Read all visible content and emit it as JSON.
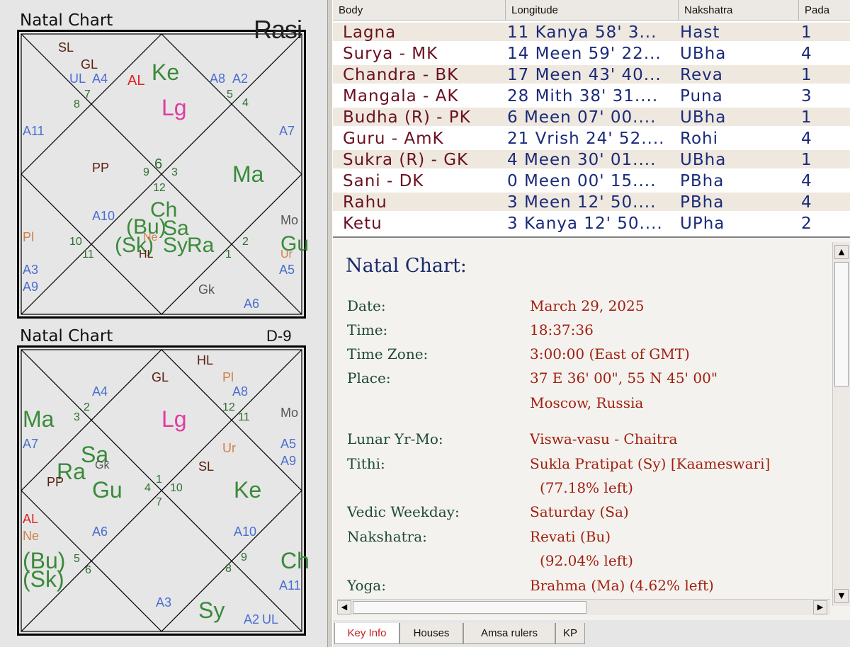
{
  "rasi": {
    "title": "Natal Chart",
    "name": "Rasi",
    "labels": {
      "sl": "SL",
      "gl": "GL",
      "ul": "UL",
      "a4": "A4",
      "al": "AL",
      "ke": "Ke",
      "a8": "A8",
      "a2": "A2",
      "lg": "Lg",
      "n7": "7",
      "n8": "8",
      "n5": "5",
      "n4": "4",
      "a11": "A11",
      "a7": "A7",
      "pp": "PP",
      "n9": "9",
      "n6": "6",
      "n3": "3",
      "n12": "12",
      "ma": "Ma",
      "a10": "A10",
      "ch": "Ch",
      "bu": "(Bu)",
      "sa": "Sa",
      "mo": "Mo",
      "pl": "Pl",
      "n10": "10",
      "n11": "11",
      "sk": "(Sk)",
      "ne": "Ne",
      "sy": "Sy",
      "ra": "Ra",
      "hl": "HL",
      "n1": "1",
      "n2": "2",
      "gu": "Gu",
      "ur": "Ur",
      "a3": "A3",
      "a5": "A5",
      "a9": "A9",
      "gk": "Gk",
      "a6": "A6"
    }
  },
  "d9": {
    "title": "Natal Chart",
    "name": "D-9",
    "labels": {
      "hl": "HL",
      "gl": "GL",
      "pl": "Pl",
      "a4": "A4",
      "a8": "A8",
      "lg": "Lg",
      "n3": "3",
      "n2": "2",
      "n12": "12",
      "n11": "11",
      "mo": "Mo",
      "ma": "Ma",
      "a7": "A7",
      "ur": "Ur",
      "a5": "A5",
      "a9": "A9",
      "sa": "Sa",
      "ra": "Ra",
      "gk": "Gk",
      "pp": "PP",
      "gu": "Gu",
      "n4": "4",
      "n1": "1",
      "n10": "10",
      "n7": "7",
      "sl": "SL",
      "ke": "Ke",
      "al": "AL",
      "ne": "Ne",
      "a6": "A6",
      "a10": "A10",
      "bu": "(Bu)",
      "sk": "(Sk)",
      "n5": "5",
      "n6": "6",
      "n9": "9",
      "n8": "8",
      "ch": "Ch",
      "a11": "A11",
      "a3": "A3",
      "sy": "Sy",
      "a2": "A2",
      "ul": "UL"
    }
  },
  "table": {
    "headers": [
      "Body",
      "Longitude",
      "Nakshatra",
      "Pada"
    ],
    "rows": [
      {
        "body": "Lagna",
        "longitude": "11 Kanya 58' 3...",
        "nakshatra": "Hast",
        "pada": "1"
      },
      {
        "body": "Surya - MK",
        "longitude": "14 Meen 59' 22...",
        "nakshatra": "UBha",
        "pada": "4"
      },
      {
        "body": "Chandra - BK",
        "longitude": "17 Meen 43' 40...",
        "nakshatra": "Reva",
        "pada": "1"
      },
      {
        "body": "Mangala - AK",
        "longitude": "28 Mith 38' 31....",
        "nakshatra": "Puna",
        "pada": "3"
      },
      {
        "body": "Budha (R) - PK",
        "longitude": "6 Meen 07' 00....",
        "nakshatra": "UBha",
        "pada": "1"
      },
      {
        "body": "Guru - AmK",
        "longitude": "21 Vrish 24' 52....",
        "nakshatra": "Rohi",
        "pada": "4"
      },
      {
        "body": "Sukra (R) - GK",
        "longitude": "4 Meen 30' 01....",
        "nakshatra": "UBha",
        "pada": "1"
      },
      {
        "body": "Sani - DK",
        "longitude": "0 Meen 00' 15....",
        "nakshatra": "PBha",
        "pada": "4"
      },
      {
        "body": "Rahu",
        "longitude": "3 Meen 12' 50....",
        "nakshatra": "PBha",
        "pada": "4"
      },
      {
        "body": "Ketu",
        "longitude": "3 Kanya 12' 50....",
        "nakshatra": "UPha",
        "pada": "2"
      }
    ]
  },
  "info": {
    "title": "Natal Chart:",
    "date_label": "Date:",
    "date": "March 29, 2025",
    "time_label": "Time:",
    "time": "18:37:36",
    "tz_label": "Time Zone:",
    "tz": "3:00:00 (East of GMT)",
    "place_label": "Place:",
    "place1": "37 E 36' 00\", 55 N 45' 00\"",
    "place2": "Moscow, Russia",
    "lunar_label": "Lunar Yr-Mo:",
    "lunar": "Viswa-vasu - Chaitra",
    "tithi_label": "Tithi:",
    "tithi1": "Sukla Pratipat (Sy) [Kaameswari]",
    "tithi2": "(77.18% left)",
    "weekday_label": "Vedic Weekday:",
    "weekday": "Saturday (Sa)",
    "nak_label": "Nakshatra:",
    "nak1": "Revati (Bu)",
    "nak2": "(92.04% left)",
    "yoga_label": "Yoga:",
    "yoga": "Brahma (Ma) (4.62% left)"
  },
  "tabs": [
    "Key Info",
    "Houses",
    "Amsa rulers",
    "KP"
  ]
}
